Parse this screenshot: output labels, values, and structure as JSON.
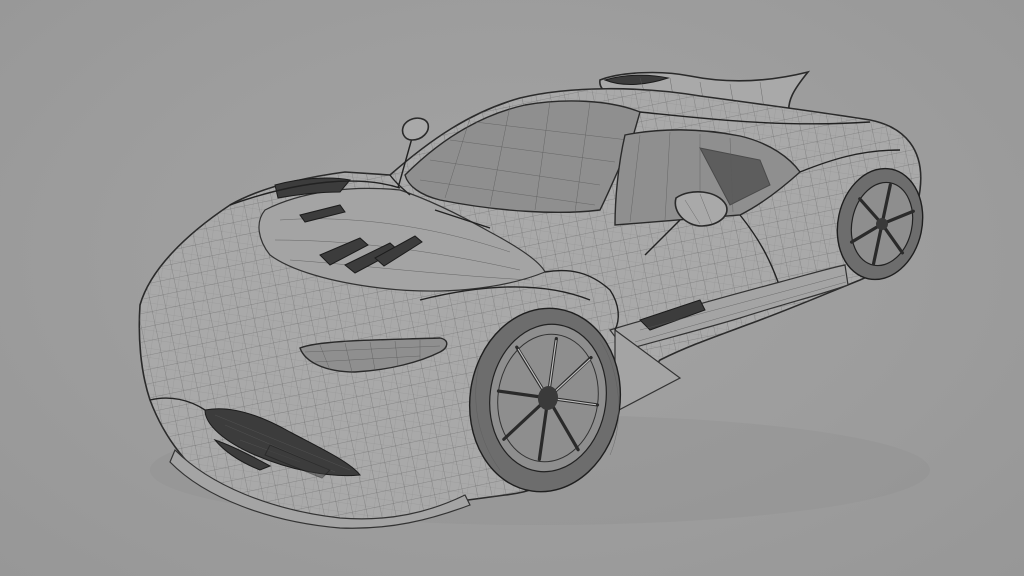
{
  "scene": {
    "subject": "hypercar-wireframe-model",
    "colors": {
      "background": "#9c9c9c",
      "body": "#a9a9a9",
      "wire": "#5a5a5a",
      "outline": "#2a2a2a",
      "tire": "#6d6d6d"
    }
  }
}
